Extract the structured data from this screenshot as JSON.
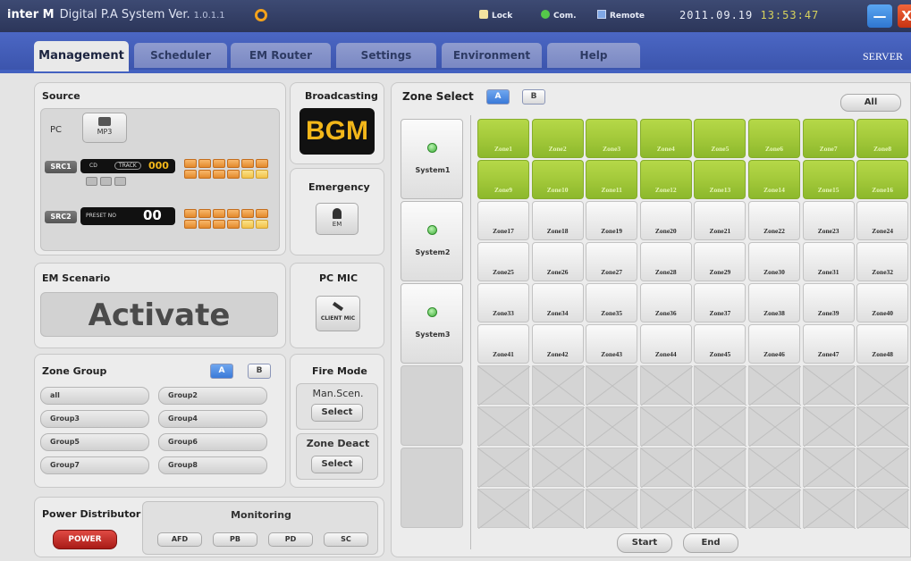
{
  "titlebar": {
    "brand": "inter M",
    "title": "Digital P.A System Ver.",
    "version": "1.0.1.1",
    "lock_label": "Lock",
    "com_label": "Com.",
    "remote_label": "Remote",
    "date": "2011.09.19",
    "time": "13:53:47",
    "minimize": "—",
    "close": "X"
  },
  "tabs": [
    "Management",
    "Scheduler",
    "EM Router",
    "Settings",
    "Environment",
    "Help"
  ],
  "active_tab": "Management",
  "server_label": "SERVER",
  "source": {
    "title": "Source",
    "pc_label": "PC",
    "mp3_label": "MP3",
    "src1_label": "SRC1",
    "src1_lcd": "CD",
    "src1_track": "TRACK",
    "src1_digits": "000",
    "src2_label": "SRC2",
    "src2_lcd": "PRESET NO",
    "src2_digits": "00"
  },
  "broadcasting": {
    "title": "Broadcasting",
    "value": "BGM"
  },
  "emergency": {
    "title": "Emergency",
    "button": "EM"
  },
  "em_scenario": {
    "title": "EM Scenario",
    "value": "Activate"
  },
  "pc_mic": {
    "title": "PC MIC",
    "button": "CLIENT MIC"
  },
  "zone_group": {
    "title": "Zone Group",
    "a_label": "A",
    "b_label": "B",
    "groups": [
      "all",
      "Group2",
      "Group3",
      "Group4",
      "Group5",
      "Group6",
      "Group7",
      "Group8"
    ]
  },
  "fire_mode": {
    "title": "Fire Mode",
    "man_scen": "Man.Scen.",
    "select1": "Select",
    "zone_deact": "Zone Deact",
    "select2": "Select"
  },
  "power_distributor": {
    "title": "Power Distributor",
    "button": "POWER"
  },
  "monitoring": {
    "title": "Monitoring",
    "buttons": [
      "AFD",
      "PB",
      "PD",
      "SC"
    ]
  },
  "zone_select": {
    "title": "Zone Select",
    "a_label": "A",
    "b_label": "B",
    "all_label": "All",
    "systems": [
      "System1",
      "System2",
      "System3"
    ],
    "zones": [
      "Zone1",
      "Zone2",
      "Zone3",
      "Zone4",
      "Zone5",
      "Zone6",
      "Zone7",
      "Zone8",
      "Zone9",
      "Zone10",
      "Zone11",
      "Zone12",
      "Zone13",
      "Zone14",
      "Zone15",
      "Zone16",
      "Zone17",
      "Zone18",
      "Zone19",
      "Zone20",
      "Zone21",
      "Zone22",
      "Zone23",
      "Zone24",
      "Zone25",
      "Zone26",
      "Zone27",
      "Zone28",
      "Zone29",
      "Zone30",
      "Zone31",
      "Zone32",
      "Zone33",
      "Zone34",
      "Zone35",
      "Zone36",
      "Zone37",
      "Zone38",
      "Zone39",
      "Zone40",
      "Zone41",
      "Zone42",
      "Zone43",
      "Zone44",
      "Zone45",
      "Zone46",
      "Zone47",
      "Zone48"
    ],
    "active_zones": 16,
    "start_label": "Start",
    "end_label": "End"
  },
  "colors": {
    "active_zone": "#a3c93a",
    "tab_bar": "#4b67c4",
    "bgm_text": "#f3b71a",
    "power": "#c62a24"
  }
}
